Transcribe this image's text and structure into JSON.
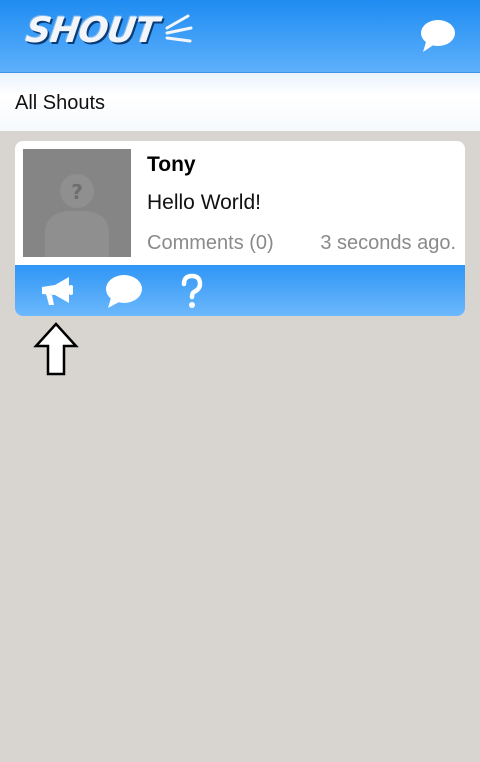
{
  "app": {
    "logo_text": "SHOUT"
  },
  "header": {
    "chat_icon": "speech-bubble-icon"
  },
  "subheader": {
    "title": "All Shouts"
  },
  "shouts": [
    {
      "author": "Tony",
      "message": "Hello World!",
      "comments_label": "Comments (0)",
      "timestamp": "3 seconds ago.",
      "avatar_icon": "default-avatar-icon",
      "actions": [
        "megaphone-icon",
        "speech-bubble-icon",
        "question-icon"
      ]
    }
  ],
  "colors": {
    "brand_blue": "#1e8cf2",
    "background": "#d8d5d1",
    "muted_text": "#8a8a8a"
  }
}
